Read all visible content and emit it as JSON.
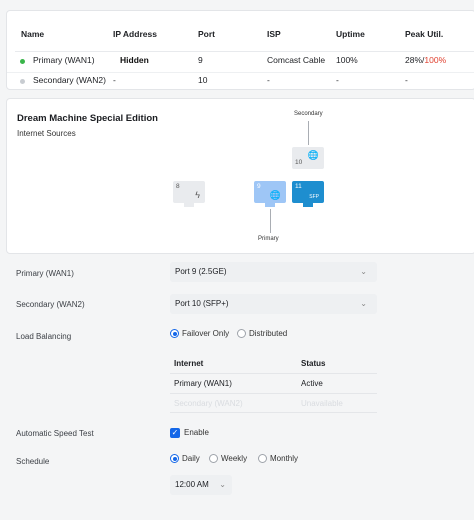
{
  "wan_table": {
    "headers": [
      "Name",
      "IP Address",
      "Port",
      "ISP",
      "Uptime",
      "Peak Util."
    ],
    "rows": [
      {
        "name": "Primary (WAN1)",
        "ip": "Hidden",
        "port": "9",
        "isp": "Comcast Cable",
        "uptime": "100%",
        "peak_a": "28%",
        "peak_sep": "/",
        "peak_b": "100%",
        "status_color": "#39b54a"
      },
      {
        "name": "Secondary (WAN2)",
        "ip": "-",
        "port": "10",
        "isp": "-",
        "uptime": "-",
        "peak": "-",
        "status_color": "#c8ccd1"
      }
    ]
  },
  "device": {
    "title": "Dream Machine Special Edition",
    "subtitle": "Internet Sources",
    "secondary_label": "Secondary",
    "primary_label": "Primary",
    "ports": [
      {
        "num": "8",
        "icon": "lightning-icon",
        "glyph": "ϟ",
        "state": "grey"
      },
      {
        "num": "9",
        "icon": "globe-icon",
        "glyph": "🌐",
        "state": "light"
      },
      {
        "num": "11",
        "icon": "sfp-label",
        "glyph": "SFP",
        "state": "blue"
      },
      {
        "num": "10",
        "icon": "globe-icon",
        "glyph": "🌐",
        "state": "grey"
      }
    ]
  },
  "form": {
    "primary_label": "Primary (WAN1)",
    "primary_value": "Port 9 (2.5GE)",
    "secondary_label": "Secondary (WAN2)",
    "secondary_value": "Port 10 (SFP+)",
    "lb_label": "Load Balancing",
    "lb_options": [
      "Failover Only",
      "Distributed"
    ],
    "lb_selected": "Failover Only",
    "lb_table": {
      "headers": [
        "Internet",
        "Status"
      ],
      "rows": [
        {
          "internet": "Primary (WAN1)",
          "status": "Active"
        },
        {
          "internet": "Secondary (WAN2)",
          "status": "Unavailable"
        }
      ]
    },
    "speed_label": "Automatic Speed Test",
    "speed_enable": "Enable",
    "speed_checked": true,
    "schedule_label": "Schedule",
    "schedule_options": [
      "Daily",
      "Weekly",
      "Monthly"
    ],
    "schedule_selected": "Daily",
    "time_value": "12:00 AM"
  },
  "colors": {
    "accent": "#1467e8",
    "active_green": "#39b54a",
    "peak_red": "#e0402f",
    "port_blue": "#1e8ecf",
    "port_light": "#9ec6f6"
  }
}
